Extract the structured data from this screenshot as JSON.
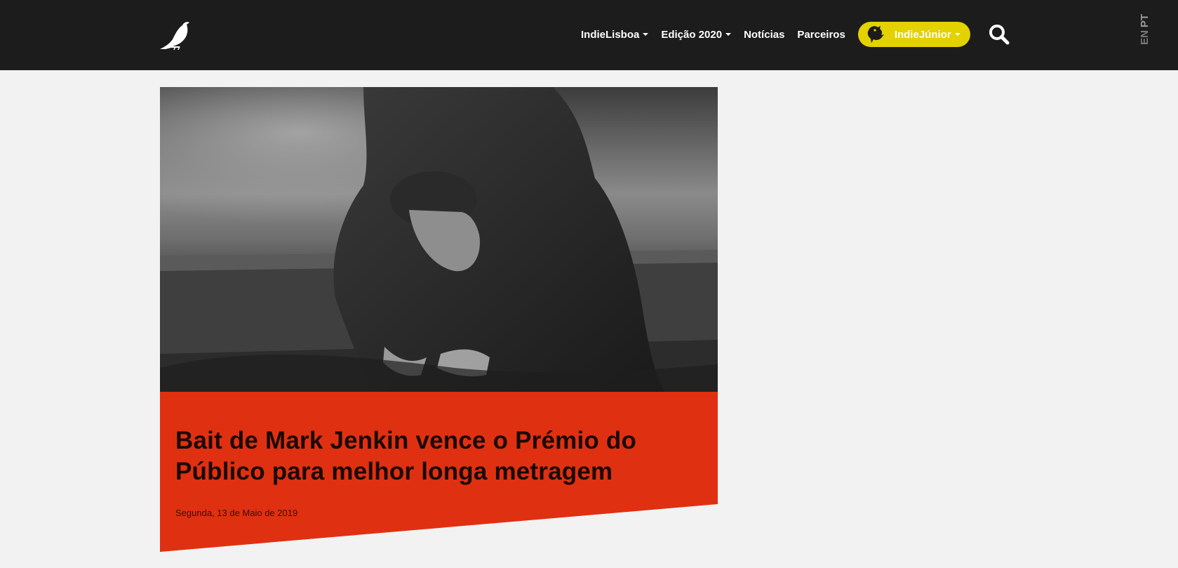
{
  "header": {
    "logo_icon": "bird-logo-icon",
    "nav": [
      {
        "label": "IndieLisboa",
        "dropdown": true
      },
      {
        "label": "Edição 2020",
        "dropdown": true
      },
      {
        "label": "Notícias",
        "dropdown": false
      },
      {
        "label": "Parceiros",
        "dropdown": false
      }
    ],
    "junior": {
      "label": "IndieJúnior",
      "icon": "bird-mascot-icon",
      "color": "#e3d100"
    },
    "search_icon": "search-icon",
    "languages": [
      "PT",
      "EN"
    ]
  },
  "article": {
    "image_desc": "black-and-white photo",
    "title": "Bait de Mark Jenkin vence o Prémio do Público para melhor longa metragem",
    "date": "Segunda, 13 de Maio de 2019",
    "accent_color": "#e03012"
  },
  "colors": {
    "header_bg": "#1c1c1c",
    "page_bg": "#f2f2f2"
  }
}
